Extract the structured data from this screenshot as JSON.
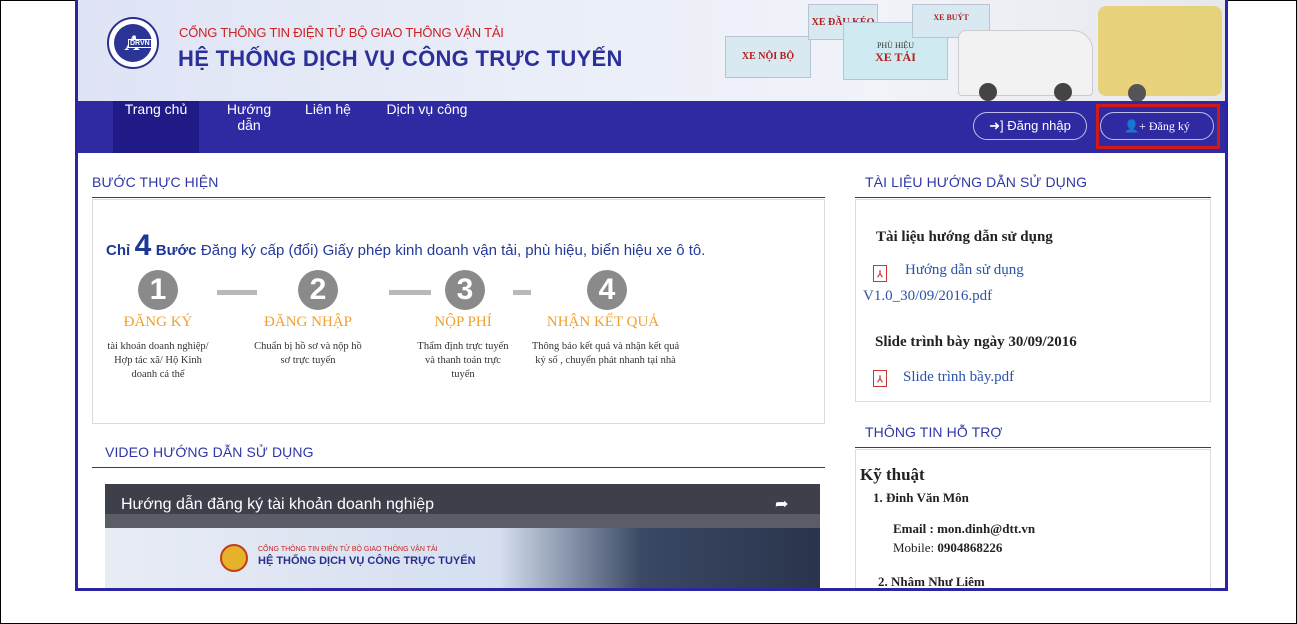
{
  "header": {
    "logo_text": "DRVN",
    "subtitle": "CỔNG THÔNG TIN ĐIỆN TỬ BỘ GIAO THÔNG VẬN TẢI",
    "title": "HỆ THỐNG DỊCH VỤ CÔNG TRỰC TUYẾN",
    "cards": [
      "XE NỘI BỘ",
      "XE ĐẦU KÉO",
      "PHÙ HIỆU",
      "XE TẢI",
      "XE BUÝT"
    ]
  },
  "nav": {
    "items": [
      "Trang chủ",
      "Hướng dẫn",
      "Liên hệ",
      "Dịch vụ công"
    ],
    "login": "Đăng nhập",
    "register": "Đăng ký"
  },
  "steps_section": {
    "title": "BƯỚC THỰC HIỆN",
    "chi": "Chỉ",
    "count": "4",
    "buoc": "Bước",
    "desc": "Đăng ký cấp (đổi) Giấy phép kinh doanh vận tải, phù hiệu, biển hiệu xe ô tô.",
    "steps": [
      {
        "num": "1",
        "title": "ĐĂNG KÝ",
        "desc": "tài khoản doanh nghiệp/ Hợp tác xã/ Hộ Kinh doanh cá thể"
      },
      {
        "num": "2",
        "title": "ĐĂNG NHẬP",
        "desc": "Chuẩn bị hồ sơ và nộp hồ sơ trực tuyến"
      },
      {
        "num": "3",
        "title": "NỘP PHÍ",
        "desc": "Thẩm định trực tuyến và thanh toán trực tuyến"
      },
      {
        "num": "4",
        "title": "NHẬN KẾT QUẢ",
        "desc": "Thông báo kết quả và nhận kết quả ký số , chuyển phát nhanh tại nhà"
      }
    ]
  },
  "video_section": {
    "title": "VIDEO HƯỚNG DẪN SỬ DỤNG",
    "video_title": "Hướng dẫn đăng ký tài khoản doanh nghiệp",
    "site_subtitle": "CỔNG THÔNG TIN ĐIỆN TỬ BỘ GIAO THÔNG VẬN TẢI",
    "site_title": "HỆ THỐNG DỊCH VỤ CÔNG TRỰC TUYẾN"
  },
  "docs_section": {
    "title": "TÀI LIỆU HƯỚNG DẪN SỬ DỤNG",
    "heading1": "Tài liệu hướng dẫn sử dụng",
    "link1_line1": "Hướng dẫn sử dụng",
    "link1_line2": "V1.0_30/09/2016.pdf",
    "heading2": "Slide trình bày ngày 30/09/2016",
    "link2": "Slide trình bầy.pdf"
  },
  "support_section": {
    "title": "THÔNG TIN HỖ TRỢ",
    "category": "Kỹ thuật",
    "person1": "1. Đinh Văn Môn",
    "email_label": "Email :",
    "email": "mon.dinh@dtt.vn",
    "mobile_label": "Mobile:",
    "mobile": "0904868226",
    "person2": "2. Nhâm Như Liêm"
  }
}
